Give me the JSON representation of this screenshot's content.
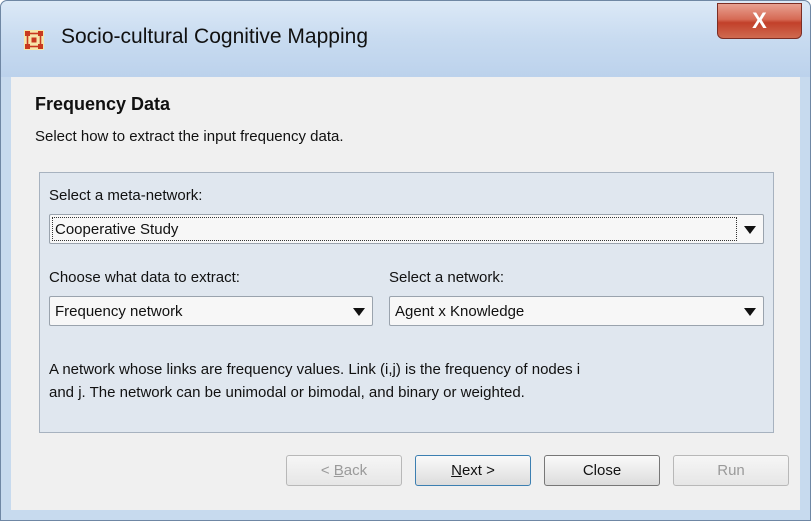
{
  "window": {
    "title": "Socio-cultural Cognitive Mapping",
    "close_label": "X"
  },
  "header": {
    "heading": "Frequency Data",
    "description": "Select how to extract the input frequency data."
  },
  "form": {
    "meta_network_label": "Select a meta-network:",
    "meta_network_value": "Cooperative Study",
    "extract_label": "Choose what data to extract:",
    "extract_value": "Frequency network",
    "network_label": "Select a network:",
    "network_value": "Agent x Knowledge",
    "info_line1": "A network whose links are frequency values. Link (i,j) is the frequency of nodes i",
    "info_line2": "and j. The network can be unimodal or bimodal, and binary or weighted."
  },
  "buttons": {
    "back_prefix": "< ",
    "back_mnemonic": "B",
    "back_rest": "ack",
    "next_mnemonic": "N",
    "next_rest": "ext >",
    "close": "Close",
    "run": "Run"
  },
  "icons": {
    "app": "ora-network-icon",
    "dropdown": "chevron-down-icon"
  },
  "colors": {
    "titlebar": "#c8dbf0",
    "close_button": "#c2402a",
    "panel": "#e0e7ef",
    "client": "#f0f0f0",
    "app_icon": "#c8391f"
  }
}
